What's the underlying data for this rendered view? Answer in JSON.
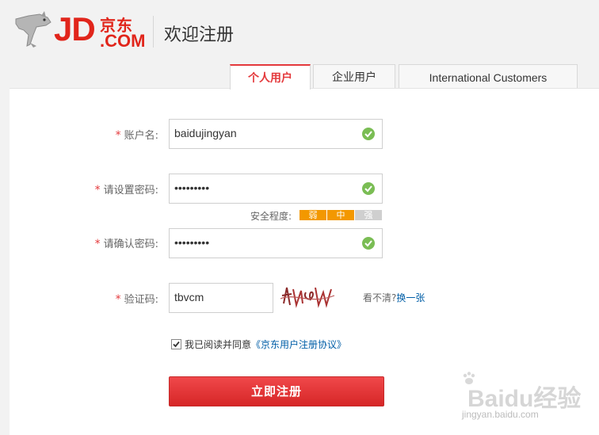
{
  "brand": {
    "logo_jd": "JD",
    "logo_cn": "京东",
    "logo_com": ".COM",
    "accent": "#e1251b"
  },
  "header": {
    "title": "欢迎注册"
  },
  "tabs": [
    {
      "label": "个人用户",
      "active": true
    },
    {
      "label": "企业用户",
      "active": false
    },
    {
      "label": "International Customers",
      "active": false
    }
  ],
  "form": {
    "username": {
      "label": "账户名:",
      "value": "baidujingyan"
    },
    "password": {
      "label": "请设置密码:",
      "value": "•••••••••"
    },
    "strength": {
      "label": "安全程度:",
      "weak": "弱",
      "medium": "中",
      "strong": "强",
      "level": "medium"
    },
    "confirm": {
      "label": "请确认密码:",
      "value": "•••••••••"
    },
    "captcha": {
      "label": "验证码:",
      "value": "tbvcm",
      "hint": "看不清?",
      "refresh": "换一张"
    },
    "agreement": {
      "prefix": "我已阅读并同意",
      "link": "《京东用户注册协议》",
      "checked": true
    },
    "submit_label": "立即注册"
  },
  "watermark": {
    "text": "Baidu经验",
    "sub": "jingyan.baidu.com"
  }
}
